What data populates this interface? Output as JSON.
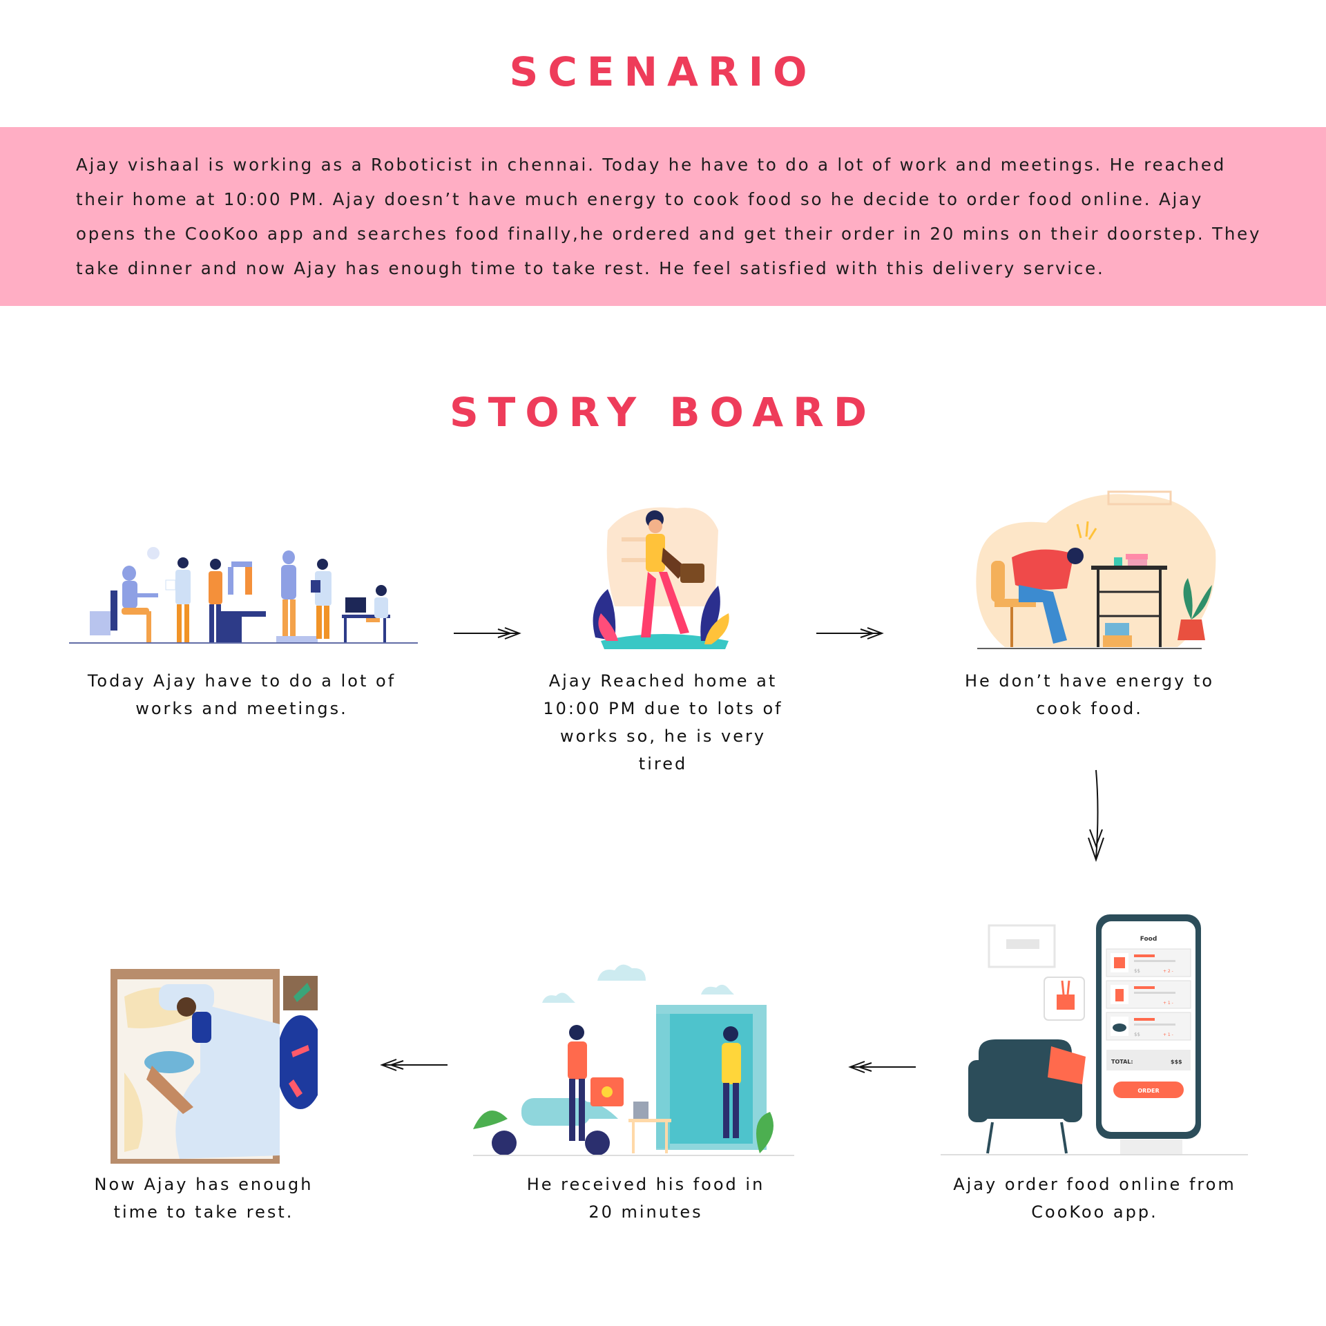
{
  "scenario": {
    "title": "SCENARIO",
    "text": "Ajay vishaal is working as a Roboticist in chennai. Today he have to do a lot of work and meetings. He reached their home at 10:00 PM. Ajay doesn’t have much energy to cook food so he decide to order food online. Ajay opens the CooKoo app and searches food finally,he ordered and get their order in 20 mins on their doorstep. They take dinner and now Ajay has enough time to take rest. He feel satisfied with this delivery service."
  },
  "storyboard": {
    "title": "STORY BOARD",
    "panels": [
      {
        "caption": "Today Ajay have to do a lot of works and meetings."
      },
      {
        "caption": "Ajay Reached home at 10:00 PM due to lots of works so, he is very tired"
      },
      {
        "caption": "He don’t have energy to cook food."
      },
      {
        "caption": "Ajay order food online from CooKoo app."
      },
      {
        "caption": "He received his food in 20 minutes"
      },
      {
        "caption": "Now Ajay has enough time to take rest."
      }
    ]
  },
  "app_mockup": {
    "screen_title": "Food",
    "total_label": "TOTAL:",
    "total_value": "$$$",
    "order_button": "ORDER",
    "price_placeholder": "$$",
    "quantities": [
      "+ 2 -",
      "+ 1 -",
      "+ 1 -"
    ]
  },
  "colors": {
    "accent": "#ee3c5a",
    "band": "#ffaec4"
  }
}
